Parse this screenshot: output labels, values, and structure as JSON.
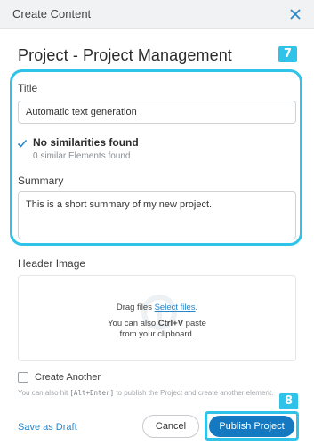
{
  "dialog": {
    "title": "Create Content",
    "page_title": "Project - Project Management"
  },
  "badges": {
    "first": "7",
    "second": "8"
  },
  "form": {
    "title_label": "Title",
    "title_value": "Automatic text generation",
    "similarity_title": "No similarities found",
    "similarity_sub": "0 similar Elements found",
    "summary_label": "Summary",
    "summary_value": "This is a short summary of my new project.",
    "header_image_label": "Header Image",
    "drag_text": "Drag files ",
    "select_files": "Select files",
    "drag_suffix": ".",
    "paste_prefix": "You can also ",
    "paste_shortcut": "Ctrl+V",
    "paste_suffix": " paste",
    "paste_line2": "from your clipboard.",
    "create_another_label": "Create Another",
    "create_another_checked": false,
    "hint_prefix": "You can also hit ",
    "hint_shortcut": "[Alt+Enter]",
    "hint_suffix": " to publish the Project and create another element."
  },
  "actions": {
    "save_draft": "Save as Draft",
    "cancel": "Cancel",
    "publish": "Publish Project"
  },
  "colors": {
    "accent_highlight": "#2fc3ea",
    "primary_button": "#1479c0",
    "link": "#2a86c9"
  }
}
